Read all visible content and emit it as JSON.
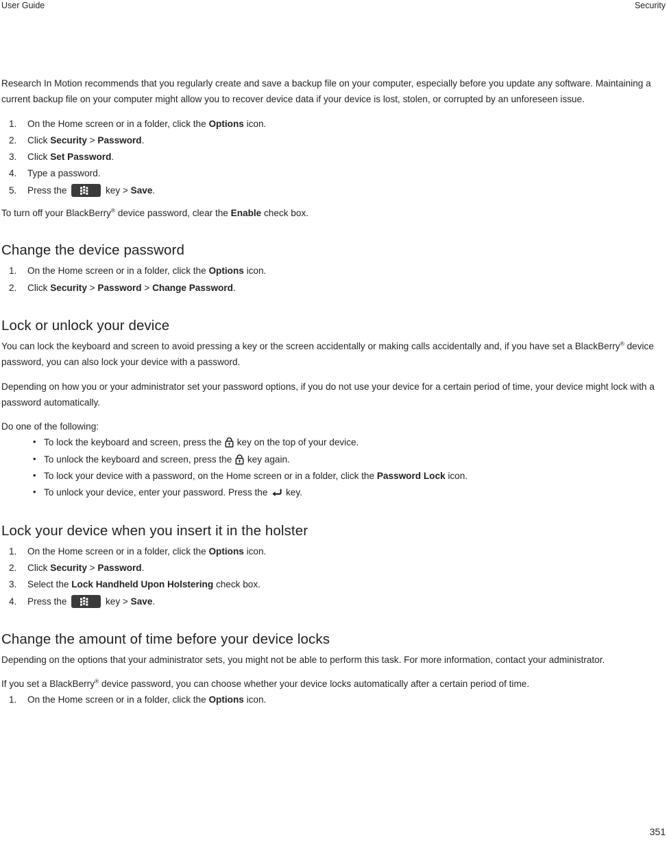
{
  "header": {
    "left": "User Guide",
    "right": "Security"
  },
  "intro": {
    "paragraph": "Research In Motion recommends that you regularly create and save a backup file on your computer, especially before you update any software. Maintaining a current backup file on your computer might allow you to recover device data if your device is lost, stolen, or corrupted by an unforeseen issue."
  },
  "set_password_steps": [
    {
      "num": "1.",
      "pre": "On the Home screen or in a folder, click the ",
      "bold": "Options",
      "post": " icon."
    },
    {
      "num": "2.",
      "pre": "Click ",
      "bold": "Security",
      "mid": " > ",
      "bold2": "Password",
      "post": "."
    },
    {
      "num": "3.",
      "pre": "Click ",
      "bold": "Set Password",
      "post": "."
    },
    {
      "num": "4.",
      "pre": "Type a password.",
      "bold": "",
      "post": ""
    },
    {
      "num": "5.",
      "pre": "Press the ",
      "icon": "blackberry-menu-key-icon",
      "mid": " key > ",
      "bold": "Save",
      "post": "."
    }
  ],
  "turn_off_note": {
    "pre": "To turn off your BlackBerry",
    "reg": "®",
    "mid": " device password, clear the ",
    "bold": "Enable",
    "post": " check box."
  },
  "section_change_password": {
    "heading": "Change the device password",
    "steps": [
      {
        "num": "1.",
        "pre": "On the Home screen or in a folder, click the ",
        "bold": "Options",
        "post": " icon."
      },
      {
        "num": "2.",
        "pre": "Click ",
        "bold": "Security",
        "mid": " > ",
        "bold2": "Password",
        "mid2": " > ",
        "bold3": "Change Password",
        "post": "."
      }
    ]
  },
  "section_lock_unlock": {
    "heading": "Lock or unlock your device",
    "paragraph1_pre": "You can lock the keyboard and screen to avoid pressing a key or the screen accidentally or making calls accidentally and, if you have set a BlackBerry",
    "paragraph1_reg": "®",
    "paragraph1_post": " device password, you can also lock your device with a password.",
    "paragraph2": "Depending on how you or your administrator set your password options, if you do not use your device for a certain period of time, your device might lock with a password automatically.",
    "lead_in": "Do one of the following:",
    "bullets": [
      {
        "dot": "•",
        "pre": "To lock the keyboard and screen, press the ",
        "icon": "lock-key-icon",
        "post": " key on the top of your device."
      },
      {
        "dot": "•",
        "pre": "To unlock the keyboard and screen, press the ",
        "icon": "lock-key-icon",
        "post": " key again."
      },
      {
        "dot": "•",
        "pre": "To lock your device with a password, on the Home screen or in a folder, click the ",
        "bold": "Password Lock",
        "post": " icon."
      },
      {
        "dot": "•",
        "pre": "To unlock your device, enter your password. Press the ",
        "icon": "enter-key-icon",
        "post": " key."
      }
    ]
  },
  "section_holster": {
    "heading": "Lock your device when you insert it in the holster",
    "steps": [
      {
        "num": "1.",
        "pre": "On the Home screen or in a folder, click the ",
        "bold": "Options",
        "post": " icon."
      },
      {
        "num": "2.",
        "pre": "Click ",
        "bold": "Security",
        "mid": " > ",
        "bold2": "Password",
        "post": "."
      },
      {
        "num": "3.",
        "pre": "Select the ",
        "bold": "Lock Handheld Upon Holstering",
        "post": " check box."
      },
      {
        "num": "4.",
        "pre": "Press the ",
        "icon": "blackberry-menu-key-icon",
        "mid": " key > ",
        "bold": "Save",
        "post": "."
      }
    ]
  },
  "section_lock_time": {
    "heading": "Change the amount of time before your device locks",
    "paragraph1": "Depending on the options that your administrator sets, you might not be able to perform this task. For more information, contact your administrator.",
    "paragraph2_pre": "If you set a BlackBerry",
    "paragraph2_reg": "®",
    "paragraph2_post": " device password, you can choose whether your device locks automatically after a certain period of time.",
    "steps": [
      {
        "num": "1.",
        "pre": "On the Home screen or in a folder, click the ",
        "bold": "Options",
        "post": " icon."
      }
    ]
  },
  "footer": {
    "page_number": "351"
  },
  "colors": {
    "text": "#231f20",
    "menu_key_bg": "#3b3b3b",
    "page_bg": "#ffffff"
  }
}
